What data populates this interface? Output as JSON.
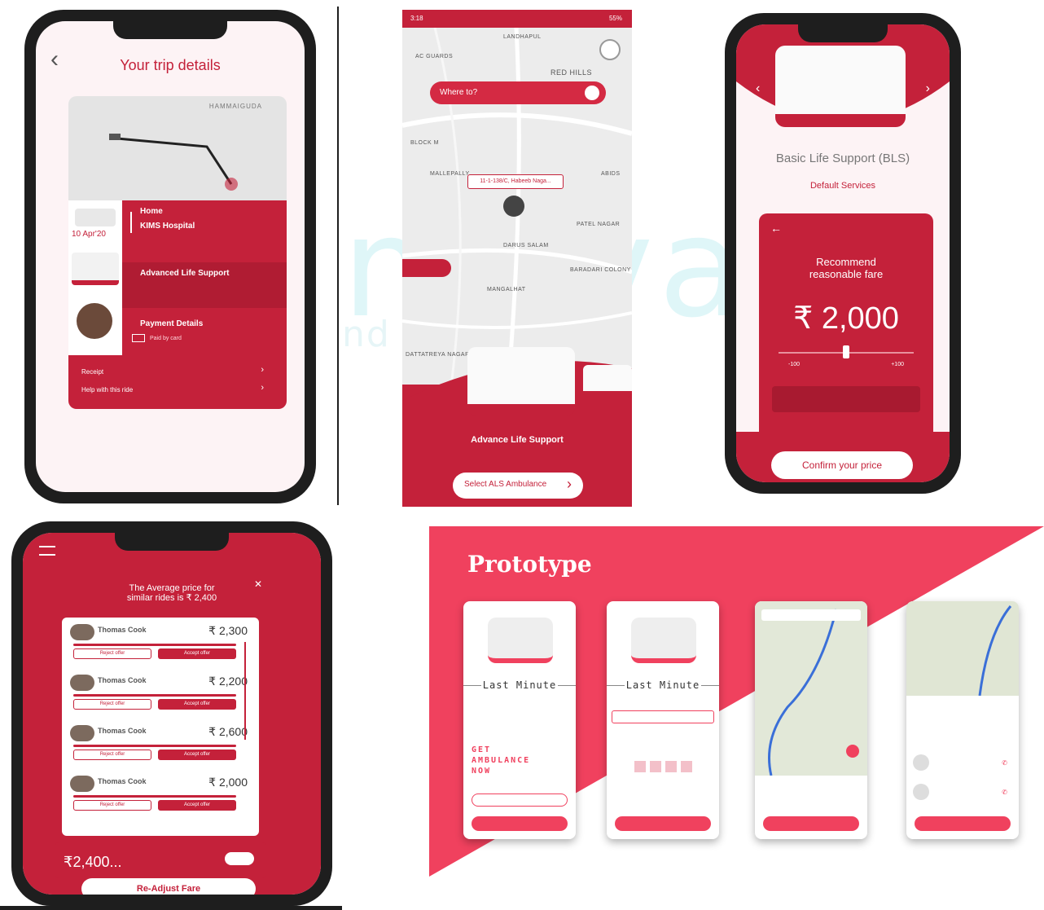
{
  "panel1": {
    "title": "Your trip details",
    "map_label": "HAMMAIGUDA",
    "date": "10 Apr'20",
    "stops": [
      "Home",
      "KIMS Hospital"
    ],
    "service": "Advanced Life Support",
    "payment_heading": "Payment Details",
    "payment_method": "Paid by card",
    "rows": [
      "Receipt",
      "Help with this ride"
    ]
  },
  "panel2": {
    "status_time": "3:18",
    "status_battery": "55%",
    "search_placeholder": "Where to?",
    "map_labels": [
      "LANDHAPUL",
      "AC GUARDS",
      "RED HILLS",
      "BLOCK M",
      "MALLEPALLY",
      "ABIDS",
      "PATEL NAGAR",
      "DARUS SALAM",
      "BARADARI COLONY",
      "MANGALHAT",
      "DATTATREYA NAGAR"
    ],
    "pin_text": "11-1-138/C, Habeeb Naga...",
    "service": "Advance Life Support",
    "select_button": "Select ALS Ambulance"
  },
  "panel3": {
    "service": "Basic Life Support (BLS)",
    "default": "Default Services",
    "recommend": "Recommend reasonable fare",
    "fare": "₹ 2,000",
    "slider_min": "-100",
    "slider_max": "+100",
    "slider_level": 0.5,
    "confirm_button": "Confirm your price"
  },
  "panel4": {
    "title_line1": "The Average price for",
    "title_line2": "similar rides is ₹ 2,400",
    "offers": [
      {
        "name": "Thomas Cook",
        "price": "₹ 2,300",
        "reject": "Reject offer",
        "accept": "Accept offer"
      },
      {
        "name": "Thomas Cook",
        "price": "₹ 2,200",
        "reject": "Reject offer",
        "accept": "Accept offer"
      },
      {
        "name": "Thomas Cook",
        "price": "₹ 2,600",
        "reject": "Reject offer",
        "accept": "Accept offer"
      },
      {
        "name": "Thomas Cook",
        "price": "₹ 2,000",
        "reject": "Reject offer",
        "accept": "Accept offer"
      }
    ],
    "summary_price": "₹2,400...",
    "button": "Re-Adjust Fare"
  },
  "panel5": {
    "title": "Prototype",
    "card1_title": "Last Minute",
    "card1_tag": "GET AMBULANCE NOW",
    "card2_title": "Last Minute",
    "colors": {
      "accent": "#c4213a",
      "prototype_bg": "#f0415e"
    }
  },
  "watermark": {
    "big": "mavam",
    "small": "nd         esear              nal"
  }
}
